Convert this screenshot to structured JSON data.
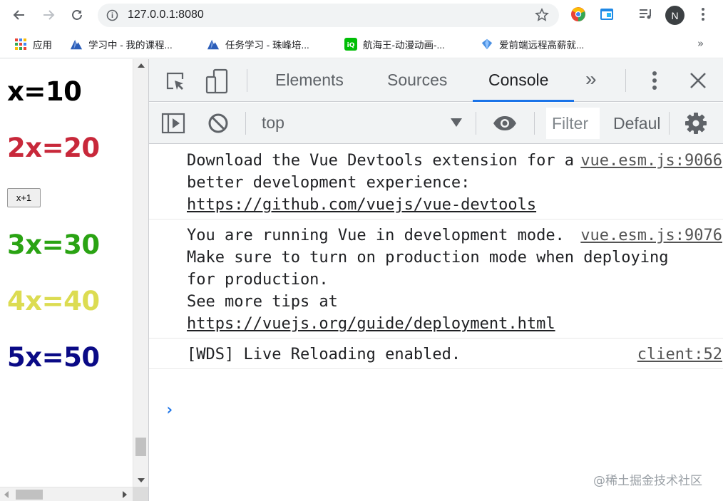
{
  "browser": {
    "url": "127.0.0.1:8080",
    "avatar_letter": "N"
  },
  "bookmarks": {
    "items": [
      {
        "label": "应用",
        "icon": "apps-grid-icon"
      },
      {
        "label": "学习中 - 我的课程...",
        "icon": "mountain-logo-icon"
      },
      {
        "label": "任务学习 - 珠峰培...",
        "icon": "mountain-logo-icon"
      },
      {
        "label": "航海王-动漫动画-...",
        "icon": "iqiyi-logo-icon"
      },
      {
        "label": "爱前端远程高薪就...",
        "icon": "diamond-logo-icon"
      }
    ],
    "more": "»"
  },
  "page": {
    "lines": [
      {
        "text": "x=10",
        "color": "#000000"
      },
      {
        "text": "2x=20",
        "color": "#c8283a"
      },
      {
        "text": "3x=30",
        "color": "#2aa313"
      },
      {
        "text": "4x=40",
        "color": "#dcdc52"
      },
      {
        "text": "5x=50",
        "color": "#0a0a86"
      }
    ],
    "button_label": "x+1"
  },
  "devtools": {
    "tabs": [
      "Elements",
      "Sources",
      "Console"
    ],
    "active_tab": "Console",
    "more_tabs": "»",
    "context": "top",
    "filter_placeholder": "Filter",
    "levels_label": "Default levels",
    "accent": "#1a73e8"
  },
  "console": {
    "messages": [
      {
        "source": "vue.esm.js:9066",
        "text": "Download the Vue Devtools extension for a better development experience:",
        "link": "https://github.com/vuejs/vue-devtools"
      },
      {
        "source": "vue.esm.js:9076",
        "text": "You are running Vue in development mode.\nMake sure to turn on production mode when deploying for production.\nSee more tips at ",
        "link": "https://vuejs.org/guide/deployment.html"
      },
      {
        "source": "client:52",
        "text": "[WDS] Live Reloading enabled.",
        "link": ""
      }
    ],
    "prompt": "›"
  },
  "watermark": "@稀土掘金技术社区"
}
